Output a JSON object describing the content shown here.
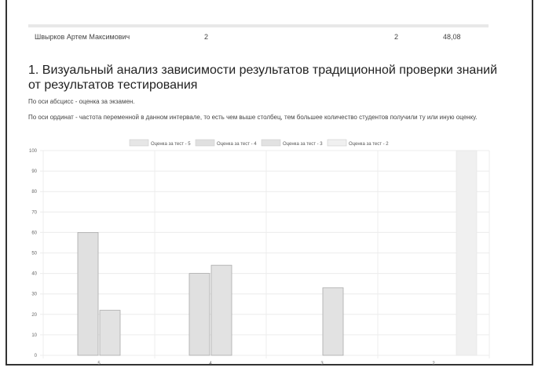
{
  "table_row": {
    "name": "Швырков Артем Максимович",
    "col2": "2",
    "col3": "2",
    "col4": "48,08"
  },
  "section": {
    "title": "1. Визуальный анализ зависимости результатов традиционной проверки знаний от результатов тестирования",
    "note_x": "По оси абсцисс - оценка за экзамен.",
    "note_y": "По оси ординат - частота переменной в данном интервале, то есть чем выше столбец, тем большее количество студентов получили ту или иную оценку."
  },
  "chart_data": {
    "type": "bar",
    "title": "",
    "xlabel": "",
    "ylabel": "",
    "ylim": [
      0,
      100
    ],
    "yticks": [
      0,
      10,
      20,
      30,
      40,
      50,
      60,
      70,
      80,
      90,
      100
    ],
    "grid": true,
    "legend_position": "top",
    "categories": [
      "5",
      "4",
      "3",
      "2"
    ],
    "series": [
      {
        "name": "Оценка за тест - 5",
        "values": [
          0,
          0,
          0,
          0
        ],
        "color": "#e6e6e6"
      },
      {
        "name": "Оценка за тест - 4",
        "values": [
          60,
          40,
          0,
          0
        ],
        "color": "#e0e0e0"
      },
      {
        "name": "Оценка за тест - 3",
        "values": [
          22,
          44,
          33,
          0
        ],
        "color": "#e2e2e2"
      },
      {
        "name": "Оценка за тест - 2",
        "values": [
          0,
          0,
          0,
          100
        ],
        "color": "#f0f0f0"
      }
    ]
  }
}
